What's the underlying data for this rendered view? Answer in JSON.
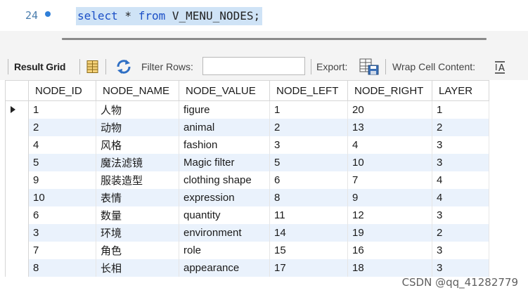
{
  "editor": {
    "line_number": "24",
    "sql_select": "select",
    "sql_star": " * ",
    "sql_from": "from",
    "sql_table": " V_MENU_NODES;"
  },
  "toolbar": {
    "result_grid_label": "Result Grid",
    "filter_rows_label": "Filter Rows:",
    "filter_value": "",
    "export_label": "Export:",
    "wrap_label": "Wrap Cell Content:",
    "icons": [
      "form-view-icon",
      "refresh-icon",
      "export-icon",
      "wrap-text-icon"
    ]
  },
  "grid": {
    "columns": [
      "NODE_ID",
      "NODE_NAME",
      "NODE_VALUE",
      "NODE_LEFT",
      "NODE_RIGHT",
      "LAYER"
    ],
    "rows": [
      [
        "1",
        "人物",
        "figure",
        "1",
        "20",
        "1"
      ],
      [
        "2",
        "动物",
        "animal",
        "2",
        "13",
        "2"
      ],
      [
        "4",
        "风格",
        "fashion",
        "3",
        "4",
        "3"
      ],
      [
        "5",
        "魔法滤镜",
        "Magic filter",
        "5",
        "10",
        "3"
      ],
      [
        "9",
        "服装造型",
        "clothing shape",
        "6",
        "7",
        "4"
      ],
      [
        "10",
        "表情",
        "expression",
        "8",
        "9",
        "4"
      ],
      [
        "6",
        "数量",
        "quantity",
        "11",
        "12",
        "3"
      ],
      [
        "3",
        "环境",
        "environment",
        "14",
        "19",
        "2"
      ],
      [
        "7",
        "角色",
        "role",
        "15",
        "16",
        "3"
      ],
      [
        "8",
        "长相",
        "appearance",
        "17",
        "18",
        "3"
      ]
    ]
  },
  "watermark": "CSDN @qq_41282779",
  "colors": {
    "keyword": "#1b4fc6",
    "sql_highlight": "#cfe3f6",
    "alt_row": "#eaf2fc",
    "toolbar_bg": "#f4f4f4"
  }
}
